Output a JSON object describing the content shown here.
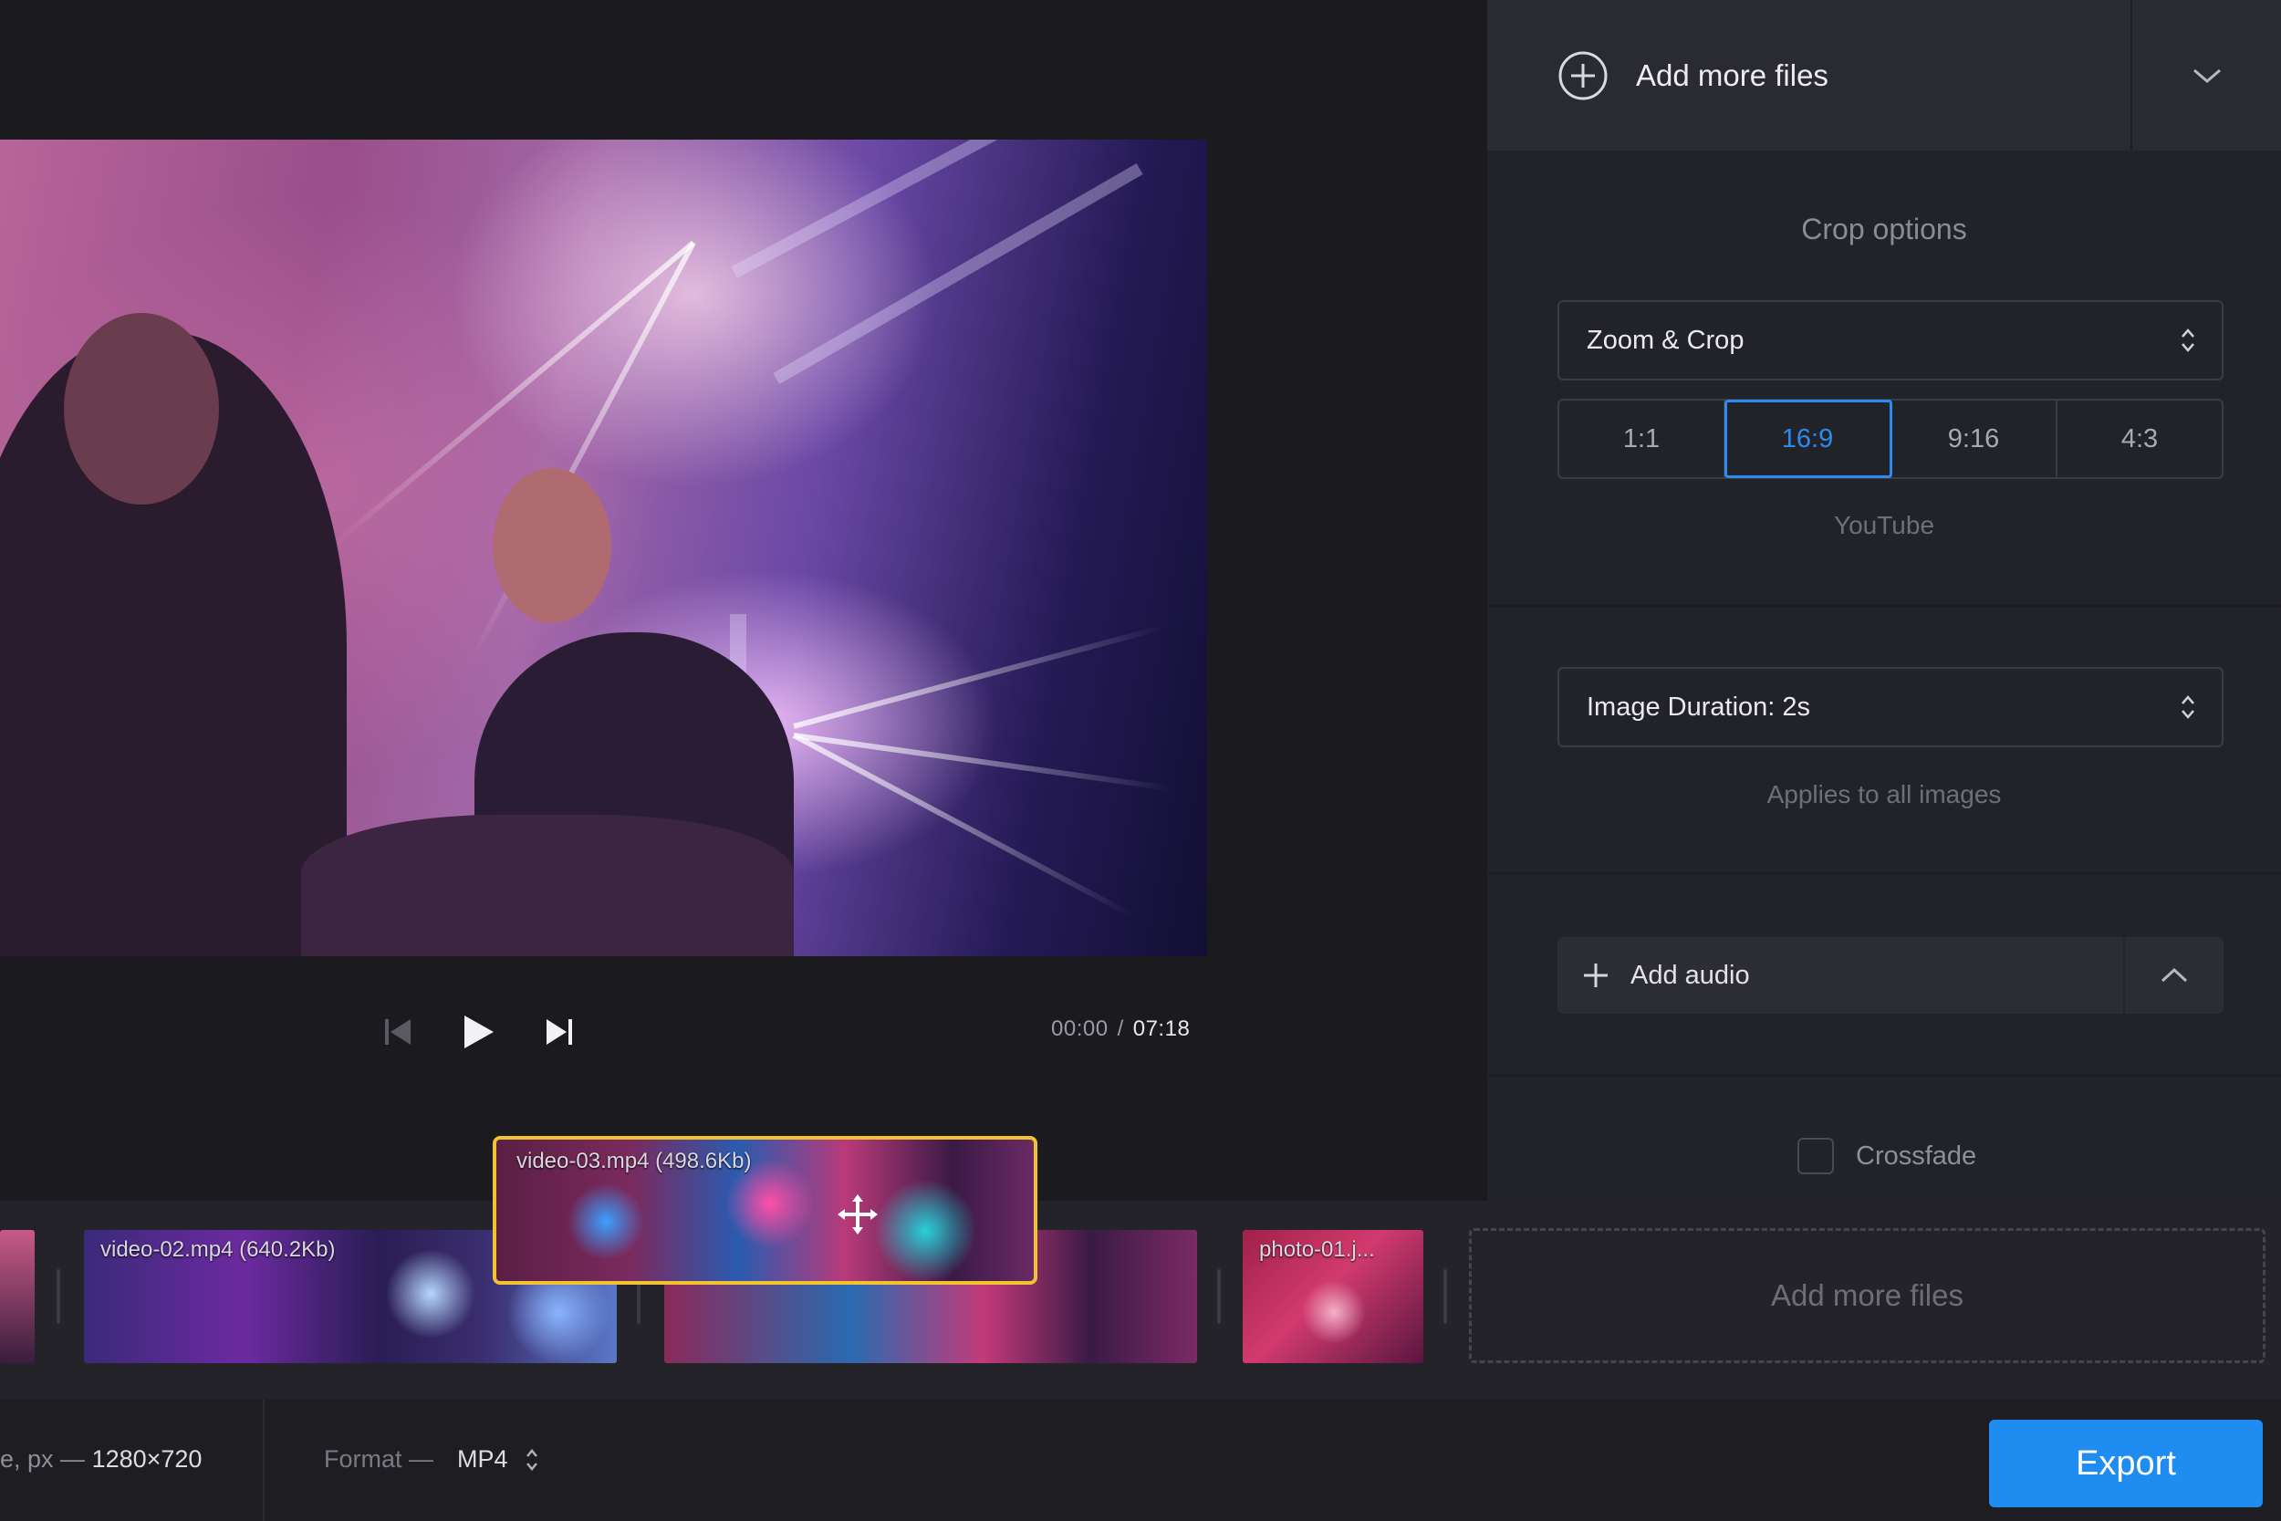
{
  "header": {
    "add_files_label": "Add more files",
    "icons": {
      "add": "plus-circle-icon",
      "expand": "chevron-down-icon"
    }
  },
  "player": {
    "current_time": "00:00",
    "separator": "/",
    "total_time": "07:18",
    "icons": {
      "prev": "skip-back-icon",
      "play": "play-icon",
      "next": "skip-forward-icon"
    }
  },
  "crop": {
    "title": "Crop options",
    "mode": "Zoom & Crop",
    "ratios": [
      "1:1",
      "16:9",
      "9:16",
      "4:3"
    ],
    "active_ratio": "16:9",
    "ratio_hint": "YouTube"
  },
  "image_duration": {
    "value": "Image Duration: 2s",
    "hint": "Applies to all images"
  },
  "audio": {
    "add_label": "Add audio",
    "icons": {
      "add": "plus-icon",
      "collapse": "chevron-up-icon"
    }
  },
  "crossfade": {
    "label": "Crossfade",
    "checked": false
  },
  "timeline": {
    "clips": [
      {
        "name": ""
      },
      {
        "name": "video-02.mp4 (640.2Kb)"
      },
      {
        "name": ""
      },
      {
        "name": "photo-01.j..."
      }
    ],
    "selected_clip": {
      "name": "video-03.mp4 (498.6Kb)"
    },
    "dropzone_label": "Add more files"
  },
  "bottom": {
    "resolution_label": "e, px —",
    "resolution_value": "1280×720",
    "format_label": "Format —",
    "format_value": "MP4",
    "export_label": "Export"
  },
  "colors": {
    "accent": "#1e8cf0",
    "selection": "#f1c232",
    "sidebar_bg": "#222229",
    "bg": "#1a1a1f"
  }
}
